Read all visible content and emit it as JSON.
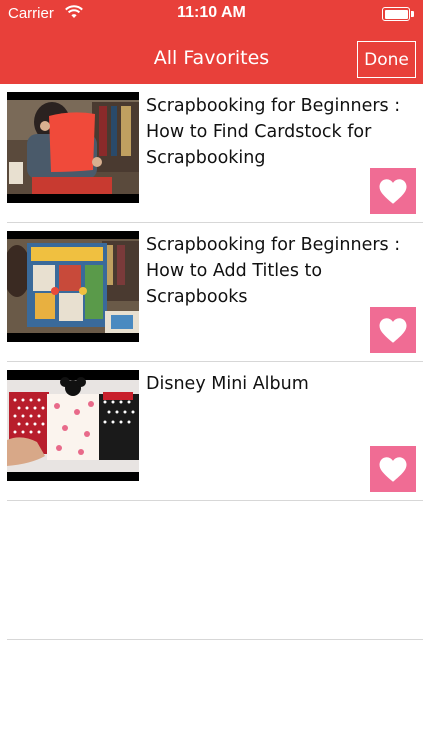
{
  "status_bar": {
    "carrier": "Carrier",
    "time": "11:10 AM"
  },
  "nav": {
    "title": "All Favorites",
    "done_label": "Done"
  },
  "colors": {
    "nav_background": "#e8403a",
    "favorite_button": "#f06c94",
    "separator": "#d7d7d7"
  },
  "videos": [
    {
      "title": "Scrapbooking for Beginners : How to Find Cardstock for Scrapbooking",
      "favorite_icon": "heart-icon"
    },
    {
      "title": "Scrapbooking for Beginners : How to Add Titles to Scrapbooks",
      "favorite_icon": "heart-icon"
    },
    {
      "title": "Disney Mini Album",
      "favorite_icon": "heart-icon"
    }
  ]
}
